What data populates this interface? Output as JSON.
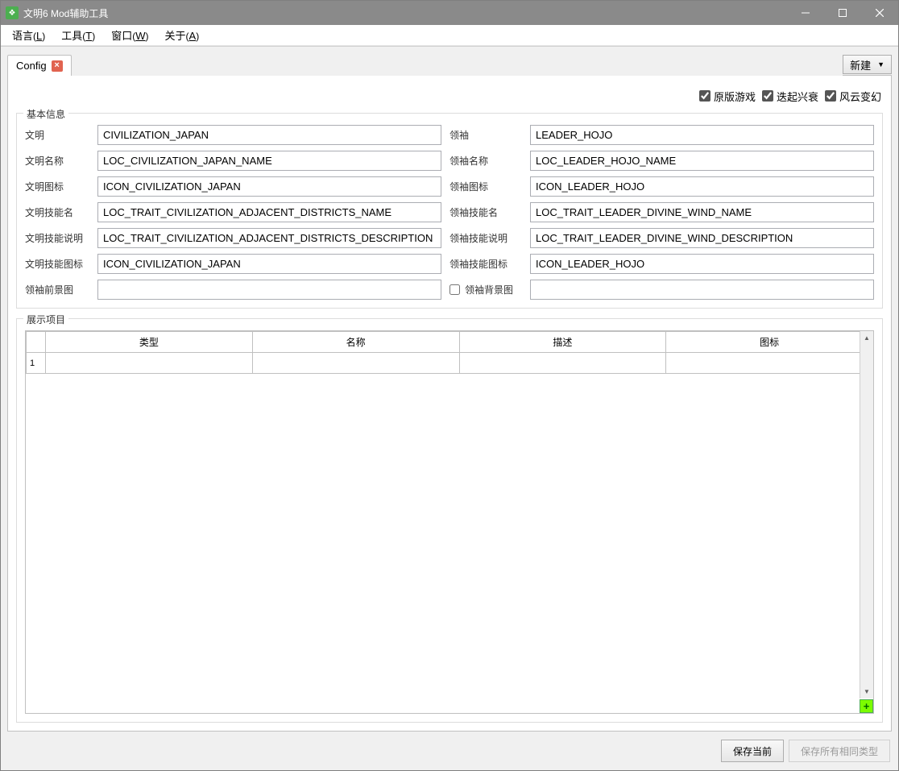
{
  "window": {
    "title": "文明6 Mod辅助工具"
  },
  "menu": {
    "language": "语言",
    "language_hotkey": "L",
    "tools": "工具",
    "tools_hotkey": "T",
    "window": "窗口",
    "window_hotkey": "W",
    "about": "关于",
    "about_hotkey": "A"
  },
  "tabs": {
    "config_label": "Config"
  },
  "toolbar": {
    "new_label": "新建"
  },
  "checkboxes": {
    "vanilla": "原版游戏",
    "vanilla_checked": true,
    "rise_fall": "迭起兴衰",
    "rise_fall_checked": true,
    "gathering_storm": "风云变幻",
    "gathering_storm_checked": true
  },
  "basic_info": {
    "legend": "基本信息",
    "rows": {
      "civ_label": "文明",
      "civ_value": "CIVILIZATION_JAPAN",
      "leader_label": "领袖",
      "leader_value": "LEADER_HOJO",
      "civ_name_label": "文明名称",
      "civ_name_value": "LOC_CIVILIZATION_JAPAN_NAME",
      "leader_name_label": "领袖名称",
      "leader_name_value": "LOC_LEADER_HOJO_NAME",
      "civ_icon_label": "文明图标",
      "civ_icon_value": "ICON_CIVILIZATION_JAPAN",
      "leader_icon_label": "领袖图标",
      "leader_icon_value": "ICON_LEADER_HOJO",
      "civ_trait_name_label": "文明技能名",
      "civ_trait_name_value": "LOC_TRAIT_CIVILIZATION_ADJACENT_DISTRICTS_NAME",
      "leader_trait_name_label": "领袖技能名",
      "leader_trait_name_value": "LOC_TRAIT_LEADER_DIVINE_WIND_NAME",
      "civ_trait_desc_label": "文明技能说明",
      "civ_trait_desc_value": "LOC_TRAIT_CIVILIZATION_ADJACENT_DISTRICTS_DESCRIPTION",
      "leader_trait_desc_label": "领袖技能说明",
      "leader_trait_desc_value": "LOC_TRAIT_LEADER_DIVINE_WIND_DESCRIPTION",
      "civ_trait_icon_label": "文明技能图标",
      "civ_trait_icon_value": "ICON_CIVILIZATION_JAPAN",
      "leader_trait_icon_label": "领袖技能图标",
      "leader_trait_icon_value": "ICON_LEADER_HOJO",
      "leader_fg_label": "领袖前景图",
      "leader_fg_value": "",
      "leader_bg_label": "领袖背景图",
      "leader_bg_checked": false,
      "leader_bg_value": ""
    }
  },
  "display_items": {
    "legend": "展示项目",
    "columns": {
      "type": "类型",
      "name": "名称",
      "desc": "描述",
      "icon": "图标"
    },
    "rows": [
      {
        "num": "1",
        "type": "",
        "name": "",
        "desc": "",
        "icon": ""
      }
    ]
  },
  "footer": {
    "save_current": "保存当前",
    "save_all_same_type": "保存所有相同类型"
  }
}
